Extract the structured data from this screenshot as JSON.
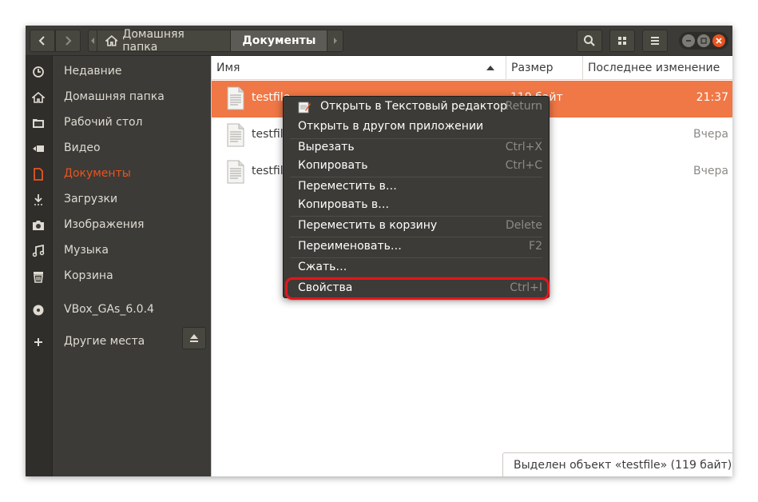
{
  "header": {
    "back_label": "",
    "path_home": "Домашняя папка",
    "path_current": "Документы"
  },
  "sidebar": {
    "items": [
      {
        "label": "Недавние",
        "icon": "clock-icon"
      },
      {
        "label": "Домашняя папка",
        "icon": "home-icon"
      },
      {
        "label": "Рабочий стол",
        "icon": "folder-icon"
      },
      {
        "label": "Видео",
        "icon": "video-camera-icon"
      },
      {
        "label": "Документы",
        "icon": "document-icon",
        "active": true
      },
      {
        "label": "Загрузки",
        "icon": "download-icon"
      },
      {
        "label": "Изображения",
        "icon": "camera-icon"
      },
      {
        "label": "Музыка",
        "icon": "music-icon"
      },
      {
        "label": "Корзина",
        "icon": "trash-icon"
      },
      {
        "label": "VBox_GAs_6.0.4",
        "icon": "disc-icon"
      },
      {
        "label": "Другие места",
        "icon": "plus-icon"
      }
    ]
  },
  "columns": {
    "name": "Имя",
    "size": "Размер",
    "modified": "Последнее изменение"
  },
  "files": [
    {
      "name": "testfile",
      "size": "119 байт",
      "modified": "21:37",
      "selected": true
    },
    {
      "name": "testfile",
      "size": "",
      "modified": "Вчера",
      "selected": false
    },
    {
      "name": "testfile",
      "size": "",
      "modified": "Вчера",
      "selected": false
    }
  ],
  "context_menu": {
    "items": [
      {
        "label": "Открыть в Текстовый редактор",
        "accel": "Return",
        "icon": "text-editor-icon"
      },
      {
        "label": "Открыть в другом приложении",
        "accel": ""
      },
      {
        "label": "Вырезать",
        "accel": "Ctrl+X"
      },
      {
        "label": "Копировать",
        "accel": "Ctrl+C"
      },
      {
        "label": "Переместить в…",
        "accel": ""
      },
      {
        "label": "Копировать в…",
        "accel": ""
      },
      {
        "label": "Переместить в корзину",
        "accel": "Delete"
      },
      {
        "label": "Переименовать…",
        "accel": "F2"
      },
      {
        "label": "Сжать…",
        "accel": ""
      },
      {
        "label": "Свойства",
        "accel": "Ctrl+I",
        "highlighted": true
      }
    ]
  },
  "status_bar": {
    "text": "Выделен объект «testfile» (119 байт)"
  },
  "colors": {
    "accent": "#e95420",
    "selection": "#f07746",
    "highlight_box": "#e2161b"
  }
}
